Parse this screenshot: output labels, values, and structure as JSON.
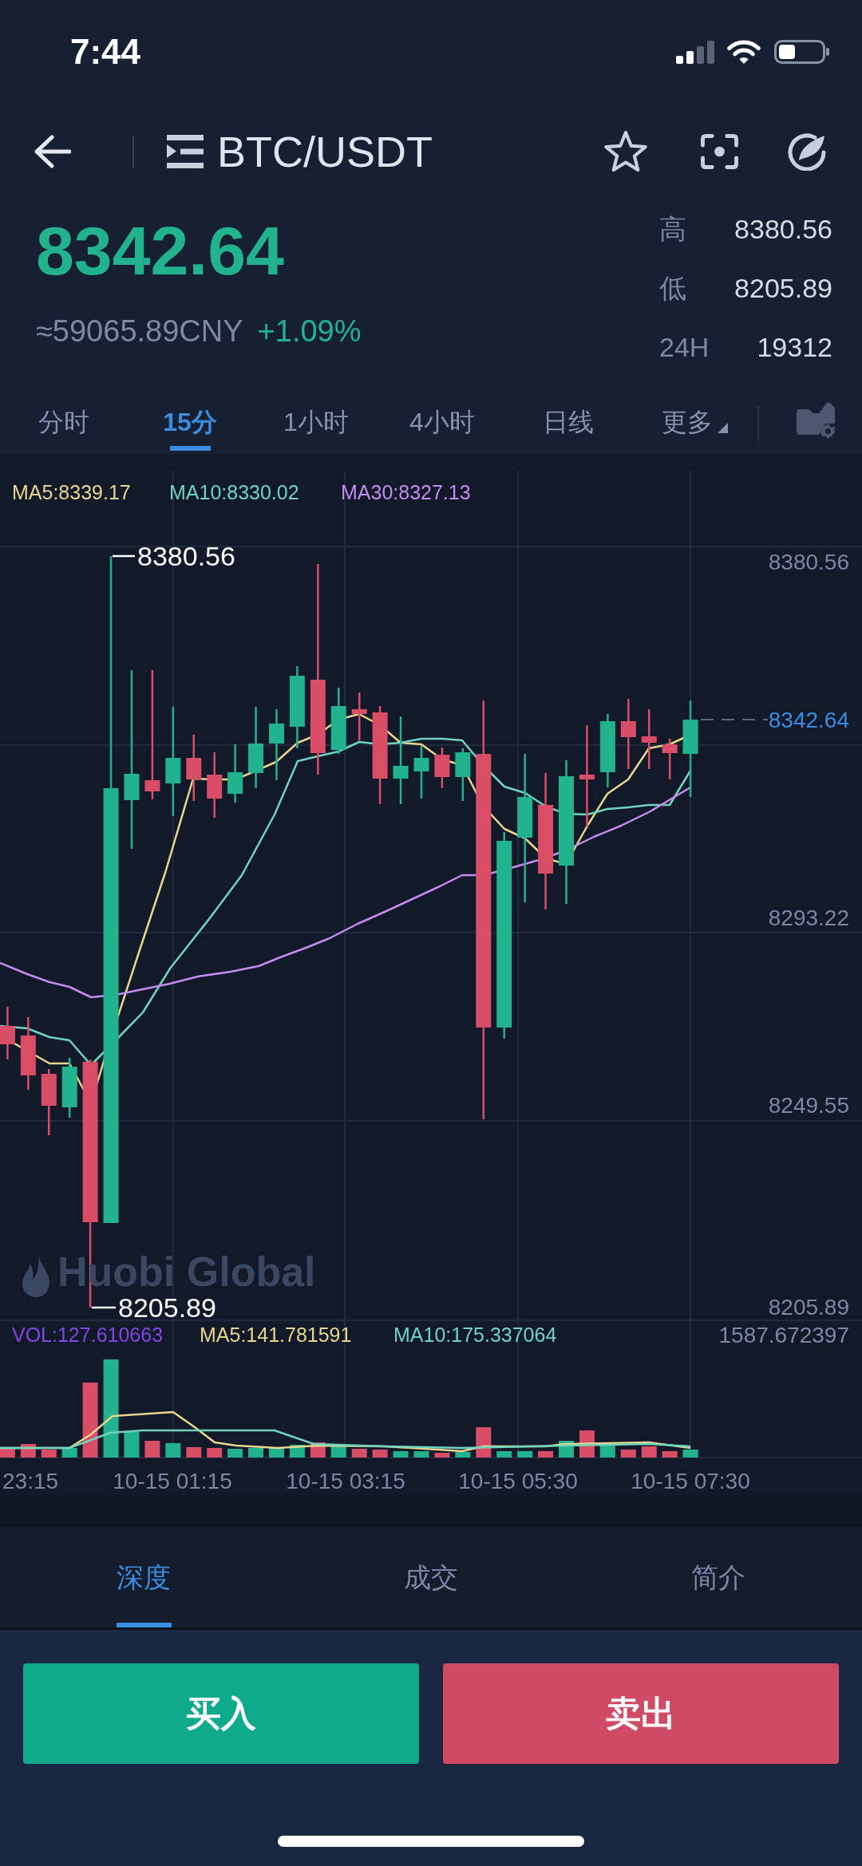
{
  "status_bar": {
    "time": "7:44"
  },
  "header": {
    "pair": "BTC/USDT",
    "favorited": false
  },
  "price": {
    "last": "8342.64",
    "converted": "≈59065.89CNY",
    "change": "+1.09%"
  },
  "stats": [
    {
      "label": "高",
      "value": "8380.56"
    },
    {
      "label": "低",
      "value": "8205.89"
    },
    {
      "label": "24H",
      "value": "19312"
    }
  ],
  "periods": [
    {
      "label": "分时",
      "kind": "period",
      "selected": false
    },
    {
      "label": "15分",
      "kind": "period",
      "selected": true
    },
    {
      "label": "1小时",
      "kind": "period",
      "selected": false
    },
    {
      "label": "4小时",
      "kind": "period",
      "selected": false
    },
    {
      "label": "日线",
      "kind": "period",
      "selected": false
    },
    {
      "label": "更多",
      "kind": "menu",
      "selected": false
    }
  ],
  "chart": {
    "legend": [
      {
        "label": "MA5:8339.17",
        "color": "#ead58f"
      },
      {
        "label": "MA10:8330.02",
        "color": "#6fd3c0"
      },
      {
        "label": "MA30:8327.13",
        "color": "#c48bf0"
      }
    ],
    "y_axis": [
      "8380.56",
      "8293.22",
      "8249.55",
      "8205.89"
    ],
    "high_label": "8380.56",
    "low_label": "8205.89",
    "last_price": "8342.64",
    "watermark": "Huobi Global"
  },
  "volume": {
    "legend": [
      {
        "label": "VOL:127.610663",
        "color": "#8445e6"
      },
      {
        "label": "MA5:141.781591",
        "color": "#ead58f"
      },
      {
        "label": "MA10:175.337064",
        "color": "#6fd3c0"
      }
    ],
    "max_label": "1587.672397"
  },
  "time_axis": [
    "23:15",
    "10-15 01:15",
    "10-15 03:15",
    "10-15 05:30",
    "10-15 07:30"
  ],
  "detail_tabs": [
    {
      "label": "深度",
      "selected": true
    },
    {
      "label": "成交",
      "selected": false
    },
    {
      "label": "简介",
      "selected": false
    }
  ],
  "actions": [
    {
      "label": "买入",
      "kind": "buy"
    },
    {
      "label": "卖出",
      "kind": "sell"
    }
  ]
}
